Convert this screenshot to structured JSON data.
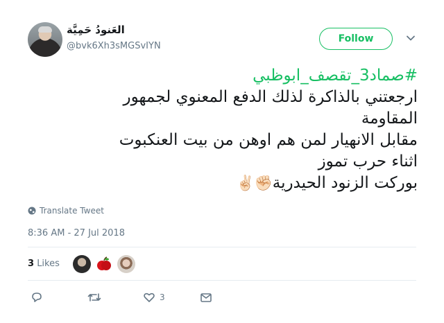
{
  "user": {
    "display_name": "العَنودُ حَمِيَّة",
    "handle": "@bvk6Xh3sMGSvIYN"
  },
  "follow_label": "Follow",
  "tweet": {
    "hashtag": "#صماد3_تقصف_ابوظبي",
    "lines": [
      "ارجعتني بالذاكرة لذلك الدفع المعنوي لجمهور",
      "المقاومة",
      "مقابل الانهيار لمن هم اوهن من بيت العنكبوت",
      "اثناء حرب تموز",
      "بوركت الزنود الحيدرية"
    ],
    "emojis": "✊🏻✌🏻"
  },
  "translate_label": "Translate Tweet",
  "timestamp": "8:36 AM - 27 Jul 2018",
  "likes": {
    "count": "3",
    "label": "Likes"
  },
  "actions": {
    "like_count": "3"
  },
  "colors": {
    "accent": "#17bf63",
    "muted": "#657786",
    "like_red": "#e0245e"
  }
}
